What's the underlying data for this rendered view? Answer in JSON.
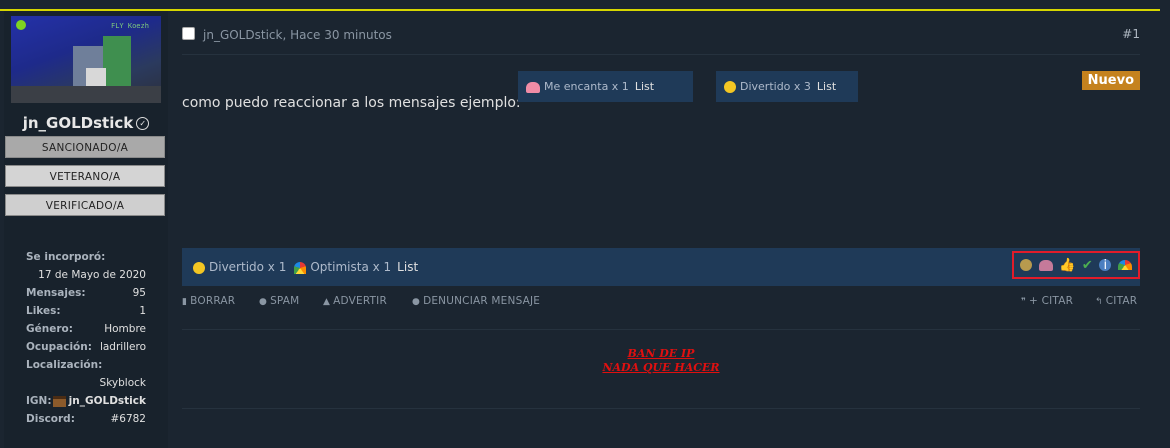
{
  "sidebar": {
    "avatar_text": "FLY Koezh",
    "username": "jn_GOLDstick",
    "badges": [
      "SANCIONADO/A",
      "VETERANO/A",
      "VERIFICADO/A"
    ],
    "info": [
      {
        "label": "Se incorporó:",
        "value": ""
      },
      {
        "label": "",
        "value": "17 de Mayo de 2020"
      },
      {
        "label": "Mensajes:",
        "value": "95"
      },
      {
        "label": "Likes:",
        "value": "1"
      },
      {
        "label": "Género:",
        "value": "Hombre"
      },
      {
        "label": "Ocupación:",
        "value": "ladrillero"
      },
      {
        "label": "Localización:",
        "value": ""
      },
      {
        "label": "",
        "value": "Skyblock"
      },
      {
        "label": "IGN:",
        "value": "jn_GOLDstick"
      },
      {
        "label": "Discord:",
        "value": "#6782"
      }
    ]
  },
  "post": {
    "meta": "jn_GOLDstick, Hace 30 minutos",
    "number": "#1",
    "new_badge": "Nuevo",
    "text": "como puedo reaccionar a los mensajes ejemplo:",
    "example_reactions": [
      {
        "label": "Me encanta x 1",
        "list": "List",
        "icon": "heart-icon"
      },
      {
        "label": "Divertido x 3",
        "list": "List",
        "icon": "laugh-emoji-icon"
      }
    ],
    "reactions_summary": [
      {
        "label": "Divertido x 1",
        "icon": "laugh-emoji-icon"
      },
      {
        "label": "Optimista x 1",
        "icon": "rainbow-icon"
      }
    ],
    "reactions_list_label": "List",
    "reaction_picker_icons": [
      "laugh-emoji-icon",
      "heart-icon",
      "thumbs-up-icon",
      "check-icon",
      "info-icon",
      "rainbow-icon"
    ],
    "actions": {
      "borrar": "BORRAR",
      "spam": "SPAM",
      "advertir": "ADVERTIR",
      "denunciar": "DENUNCIAR MENSAJE",
      "multi_citar": "+ CITAR",
      "citar": "CITAR"
    },
    "signature": [
      "BAN DE IP",
      "NADA QUE HACER"
    ]
  },
  "colors": {
    "background": "#1b2530",
    "accent_bar": "#d6d600",
    "reaction_bar": "#1f3a58",
    "new_badge": "#c5821e",
    "picker_highlight": "#e21c2a",
    "signature": "#e01010"
  }
}
